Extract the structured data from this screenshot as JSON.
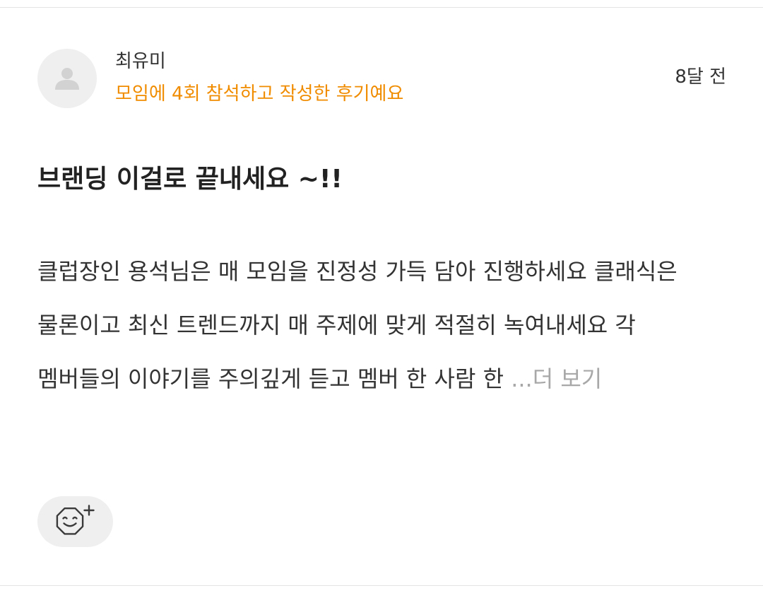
{
  "review": {
    "author": {
      "name": "최유미",
      "attendance_note": "모임에 4회 참석하고 작성한 후기예요"
    },
    "time_ago": "8달 전",
    "title": "브랜딩 이걸로 끝내세요 ~!!",
    "body_preview": "클럽장인 용석님은 매 모임을 진정성 가득 담아 진행하세요 클래식은 물론이고 최신 트렌드까지 매 주제에 맞게 적절히 녹여내세요 각 멤버들의 이야기를 주의깊게 듣고 멤버 한 사람 한 ",
    "more_label": "...더 보기"
  },
  "icons": {
    "avatar": "person-placeholder-icon",
    "reaction": "add-emoji-reaction-icon"
  },
  "colors": {
    "accent": "#f08c00",
    "more_text": "#a8a8a8",
    "avatar_bg": "#efefef"
  }
}
